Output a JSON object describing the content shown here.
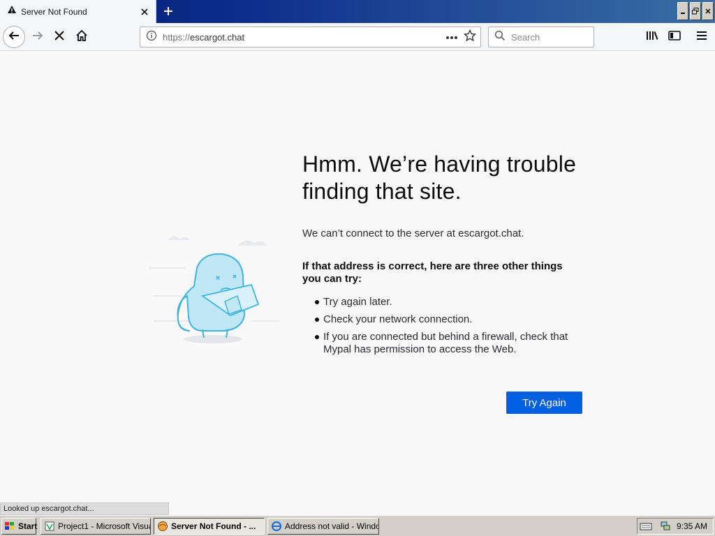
{
  "tab": {
    "title": "Server Not Found"
  },
  "urlbar": {
    "url": "https://escargot.chat",
    "protocol": "https://",
    "host": "escargot.chat"
  },
  "search": {
    "placeholder": "Search"
  },
  "error": {
    "title_line1": "Hmm. We’re having trouble",
    "title_line2": "finding that site.",
    "description": "We can’t connect to the server at escargot.chat.",
    "subtitle_line1": "If that address is correct, here are three other things",
    "subtitle_line2": "you can try:",
    "items": [
      "Try again later.",
      "Check your network connection.",
      "If you are connected but behind a firewall, check that Mypal has permission to access the Web."
    ],
    "button_label": "Try Again"
  },
  "status": {
    "text": "Looked up escargot.chat..."
  },
  "taskbar": {
    "start_label": "Start",
    "tasks": [
      {
        "label": "Project1 - Microsoft Visual..."
      },
      {
        "label": "Server Not Found - ..."
      },
      {
        "label": "Address not valid - Windo..."
      }
    ],
    "clock": "9:35 AM"
  },
  "colors": {
    "accent": "#0060df",
    "titlebar": "#0a246a"
  },
  "icons": [
    "warning-icon",
    "close-icon",
    "plus-icon",
    "back-icon",
    "forward-icon",
    "stop-icon",
    "home-icon",
    "info-icon",
    "more-icon",
    "star-icon",
    "search-icon",
    "library-icon",
    "sidebar-icon",
    "menu-icon"
  ]
}
